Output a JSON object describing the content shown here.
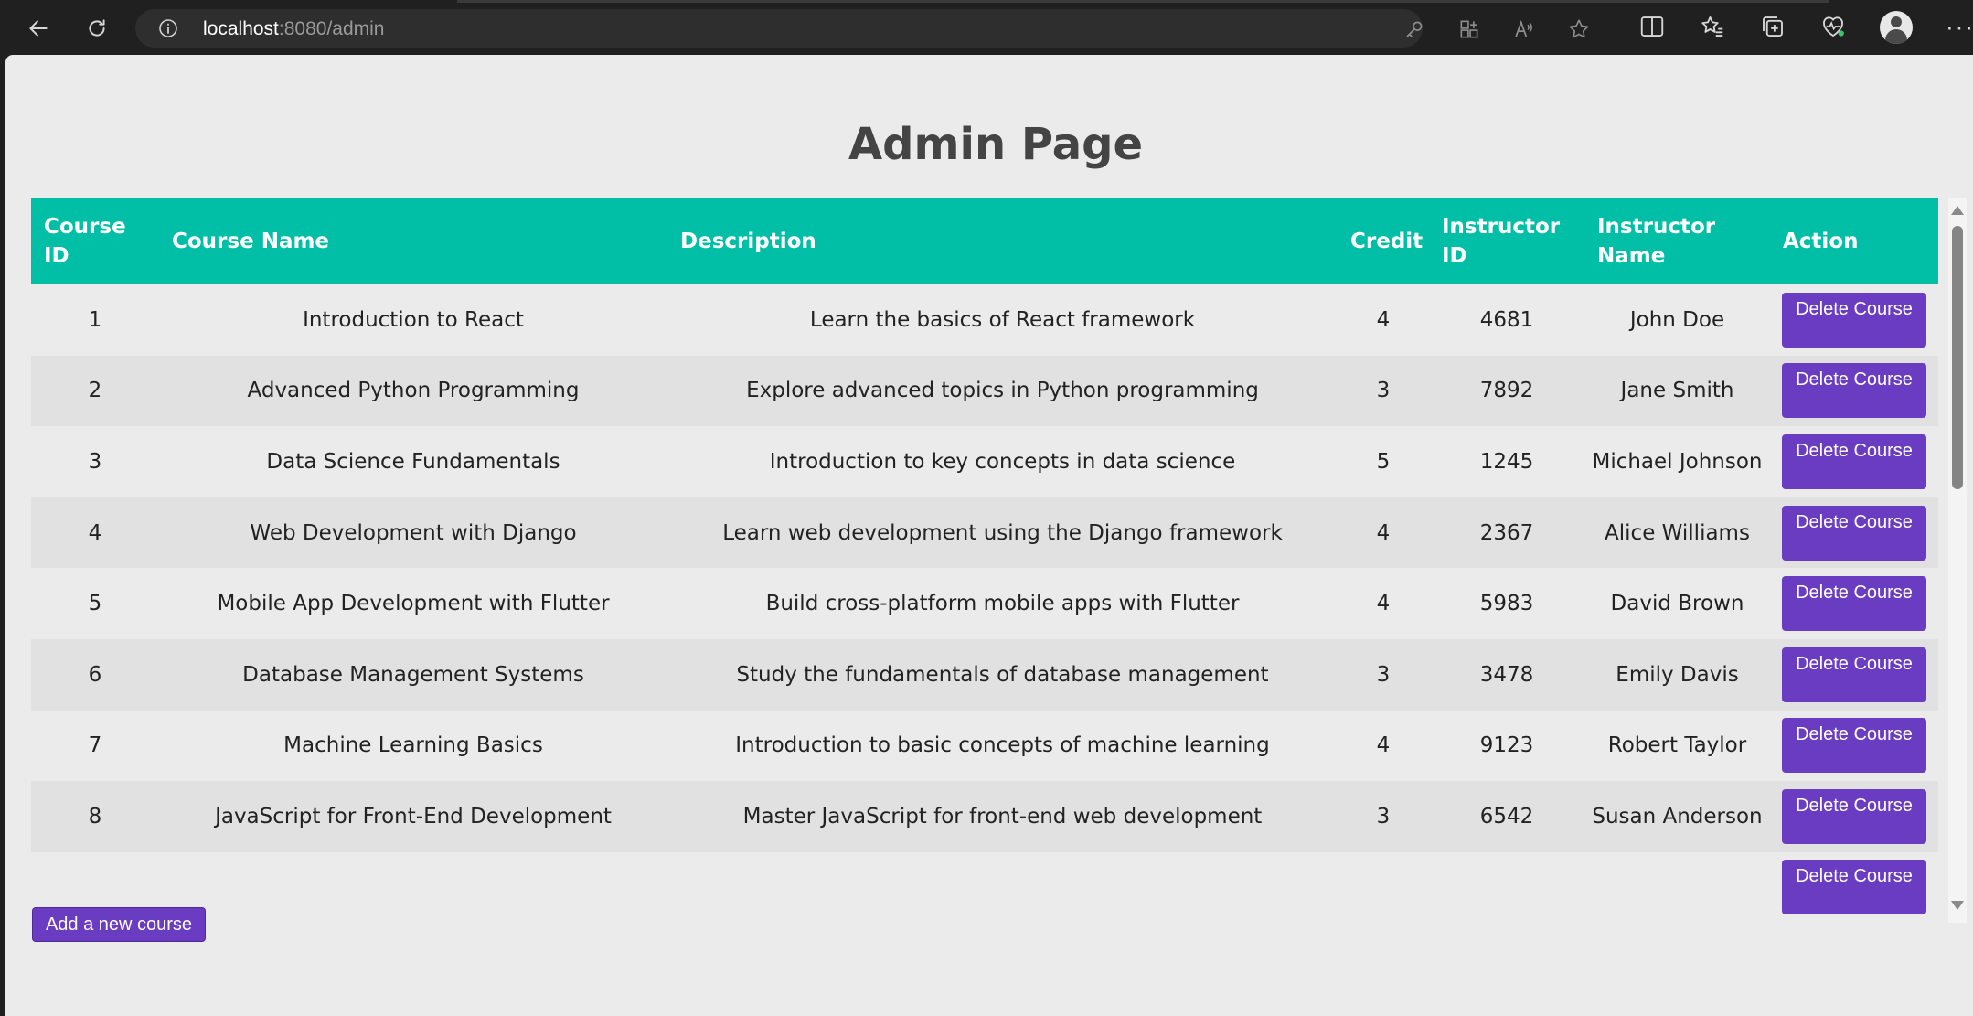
{
  "browser": {
    "url_host": "localhost",
    "url_path": ":8080/admin"
  },
  "page": {
    "title": "Admin Page",
    "add_button_label": "Add a new course"
  },
  "table": {
    "headers": {
      "course_id": "Course ID",
      "course_name": "Course Name",
      "description": "Description",
      "credit": "Credit",
      "instructor_id": "Instructor ID",
      "instructor_name": "Instructor Name",
      "action": "Action"
    },
    "delete_label": "Delete Course",
    "rows": [
      {
        "id": "1",
        "name": "Introduction to React",
        "description": "Learn the basics of React framework",
        "credit": "4",
        "instructor_id": "4681",
        "instructor_name": "John Doe"
      },
      {
        "id": "2",
        "name": "Advanced Python Programming",
        "description": "Explore advanced topics in Python programming",
        "credit": "3",
        "instructor_id": "7892",
        "instructor_name": "Jane Smith"
      },
      {
        "id": "3",
        "name": "Data Science Fundamentals",
        "description": "Introduction to key concepts in data science",
        "credit": "5",
        "instructor_id": "1245",
        "instructor_name": "Michael Johnson"
      },
      {
        "id": "4",
        "name": "Web Development with Django",
        "description": "Learn web development using the Django framework",
        "credit": "4",
        "instructor_id": "2367",
        "instructor_name": "Alice Williams"
      },
      {
        "id": "5",
        "name": "Mobile App Development with Flutter",
        "description": "Build cross-platform mobile apps with Flutter",
        "credit": "4",
        "instructor_id": "5983",
        "instructor_name": "David Brown"
      },
      {
        "id": "6",
        "name": "Database Management Systems",
        "description": "Study the fundamentals of database management",
        "credit": "3",
        "instructor_id": "3478",
        "instructor_name": "Emily Davis"
      },
      {
        "id": "7",
        "name": "Machine Learning Basics",
        "description": "Introduction to basic concepts of machine learning",
        "credit": "4",
        "instructor_id": "9123",
        "instructor_name": "Robert Taylor"
      },
      {
        "id": "8",
        "name": "JavaScript for Front-End Development",
        "description": "Master JavaScript for front-end web development",
        "credit": "3",
        "instructor_id": "6542",
        "instructor_name": "Susan Anderson"
      },
      {
        "id": "",
        "name": "",
        "description": "",
        "credit": "",
        "instructor_id": "",
        "instructor_name": ""
      }
    ]
  },
  "colors": {
    "header_bg": "#00bfa6",
    "button_bg": "#6a3cc1"
  }
}
